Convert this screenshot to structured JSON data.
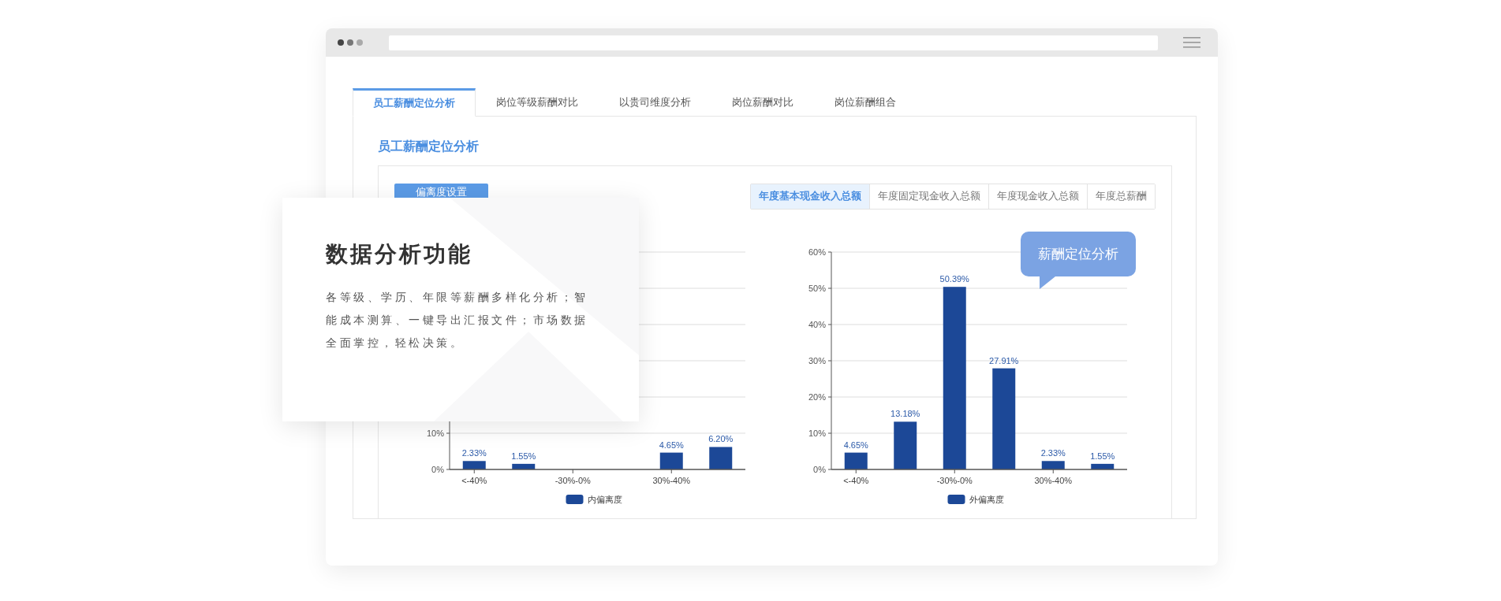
{
  "tabs": [
    {
      "label": "员工薪酬定位分析",
      "selected": true
    },
    {
      "label": "岗位等级薪酬对比",
      "selected": false
    },
    {
      "label": "以贵司维度分析",
      "selected": false
    },
    {
      "label": "岗位薪酬对比",
      "selected": false
    },
    {
      "label": "岗位薪酬组合",
      "selected": false
    }
  ],
  "section_title": "员工薪酬定位分析",
  "deviation_button": "偏离度设置",
  "metric_options": [
    {
      "label": "年度基本现金收入总额",
      "selected": true
    },
    {
      "label": "年度固定现金收入总额",
      "selected": false
    },
    {
      "label": "年度现金收入总额",
      "selected": false
    },
    {
      "label": "年度总薪酬",
      "selected": false
    }
  ],
  "charts": [
    {
      "chart_data": {
        "type": "bar",
        "categories": [
          "<-40%",
          null,
          "-30%-0%",
          null,
          "30%-40%",
          null
        ],
        "series": [
          {
            "name": "内偏离度",
            "color": "#1c4897",
            "values": [
              2.33,
              1.55,
              null,
              null,
              4.65,
              6.2
            ]
          }
        ],
        "ylim": [
          0,
          60
        ],
        "yticks": [
          {
            "value": 0,
            "label": "0%"
          },
          {
            "value": 10,
            "label": "10%"
          }
        ],
        "grid": true,
        "value_labels": [
          "2.33%",
          "1.55%",
          null,
          null,
          "4.65%",
          "6.20%"
        ]
      }
    },
    {
      "chart_data": {
        "type": "bar",
        "categories": [
          "<-40%",
          null,
          "-30%-0%",
          null,
          "30%-40%",
          null
        ],
        "series": [
          {
            "name": "外偏离度",
            "color": "#1c4897",
            "values": [
              4.65,
              13.18,
              50.39,
              27.91,
              2.33,
              1.55
            ]
          }
        ],
        "ylim": [
          0,
          60
        ],
        "yticks": [
          {
            "value": 0,
            "label": "0%"
          },
          {
            "value": 10,
            "label": "10%"
          },
          {
            "value": 20,
            "label": "20%"
          },
          {
            "value": 30,
            "label": "30%"
          },
          {
            "value": 40,
            "label": "40%"
          },
          {
            "value": 50,
            "label": "50%"
          },
          {
            "value": 60,
            "label": "60%"
          }
        ],
        "grid": true,
        "value_labels": [
          "4.65%",
          "13.18%",
          "50.39%",
          "27.91%",
          "2.33%",
          "1.55%"
        ]
      },
      "tooltip": "薪酬定位分析"
    }
  ],
  "feature_card": {
    "title": "数据分析功能",
    "description": "各等级、学历、年限等薪酬多样化分析；智能成本测算、一键导出汇报文件；市场数据全面掌控，轻松决策。"
  }
}
